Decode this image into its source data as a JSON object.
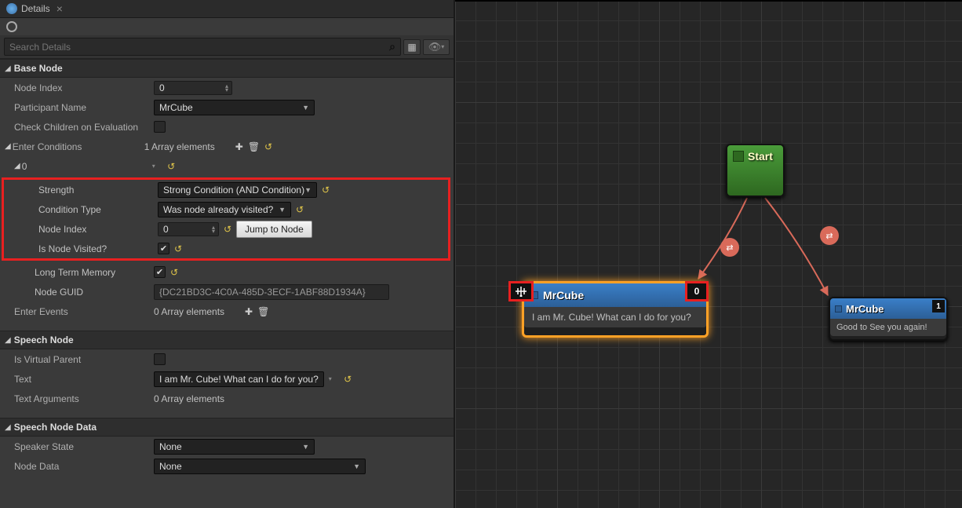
{
  "panel": {
    "title": "Details"
  },
  "search": {
    "placeholder": "Search Details"
  },
  "sections": {
    "base_node": "Base Node",
    "speech_node": "Speech Node",
    "speech_node_data": "Speech Node Data"
  },
  "base": {
    "node_index_lbl": "Node Index",
    "node_index_val": "0",
    "participant_lbl": "Participant Name",
    "participant_val": "MrCube",
    "check_children_lbl": "Check Children on Evaluation",
    "enter_conditions_lbl": "Enter Conditions",
    "enter_conditions_count": "1 Array elements",
    "item0": "0",
    "strength_lbl": "Strength",
    "strength_val": "Strong Condition (AND Condition)",
    "cond_type_lbl": "Condition Type",
    "cond_type_val": "Was node already visited?",
    "cond_index_lbl": "Node Index",
    "cond_index_val": "0",
    "jump_btn": "Jump to Node",
    "is_visited_lbl": "Is Node Visited?",
    "ltm_lbl": "Long Term Memory",
    "guid_lbl": "Node GUID",
    "guid_val": "{DC21BD3C-4C0A-485D-3ECF-1ABF88D1934A}",
    "enter_events_lbl": "Enter Events",
    "enter_events_count": "0 Array elements"
  },
  "speech": {
    "virtual_lbl": "Is Virtual Parent",
    "text_lbl": "Text",
    "text_val": "I am Mr. Cube! What can I do for you?",
    "text_args_lbl": "Text Arguments",
    "text_args_count": "0 Array elements"
  },
  "speech_data": {
    "speaker_lbl": "Speaker State",
    "speaker_val": "None",
    "node_data_lbl": "Node Data",
    "node_data_val": "None"
  },
  "graph": {
    "start": "Start",
    "n1_title": "MrCube",
    "n1_body": "I am Mr. Cube! What can I do for you?",
    "n1_index": "0",
    "n2_title": "MrCube",
    "n2_body": "Good to See you again!",
    "n2_index": "1"
  }
}
